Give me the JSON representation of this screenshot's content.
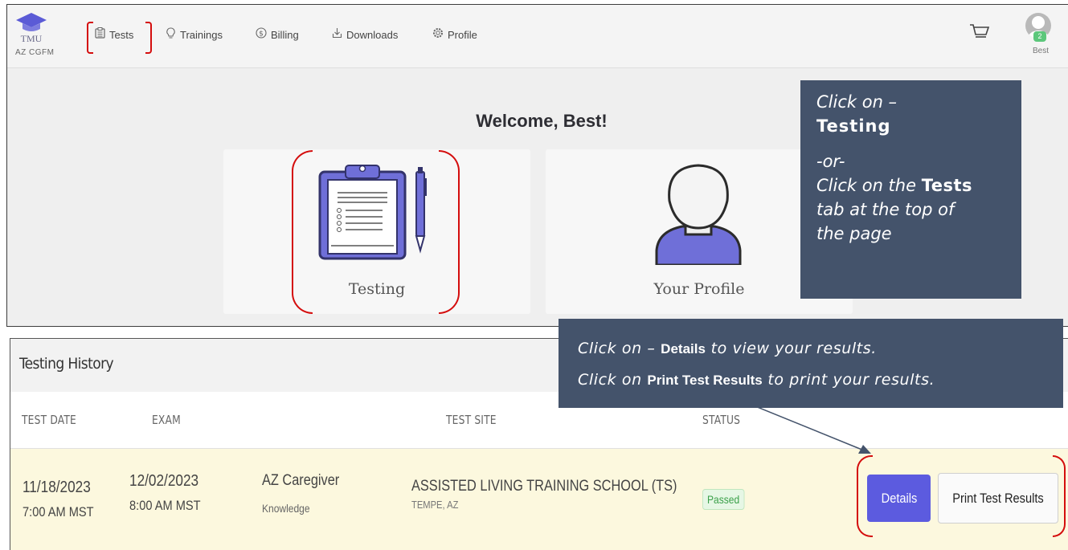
{
  "app": {
    "logo_text": "TMU",
    "org": "AZ CGFM"
  },
  "nav": {
    "items": [
      {
        "label": "Tests",
        "icon": "clipboard-icon"
      },
      {
        "label": "Trainings",
        "icon": "lightbulb-icon"
      },
      {
        "label": "Billing",
        "icon": "dollar-icon"
      },
      {
        "label": "Downloads",
        "icon": "download-icon"
      },
      {
        "label": "Profile",
        "icon": "gear-icon"
      }
    ],
    "cart_icon": "cart-icon",
    "user_badge": "2",
    "user_name": "Best"
  },
  "welcome": "Welcome, Best!",
  "cards": [
    {
      "label": "Testing",
      "icon": "clipboard-pen-icon"
    },
    {
      "label": "Your Profile",
      "icon": "person-icon"
    }
  ],
  "callout1": {
    "line1": "Click on –",
    "bold1": "Testing",
    "or": "-or-",
    "line3": "Click on the",
    "bold2": "Tests",
    "line4": "tab at the top of",
    "line5": "the page"
  },
  "callout2": {
    "a1": "Click on –",
    "b1": "Details",
    "c1": "to view your results.",
    "a2": "Click on",
    "b2": "Print Test Results",
    "c2": "to print your results."
  },
  "history": {
    "title": "Testing History",
    "columns": [
      "TEST DATE",
      "EXAM",
      "TEST SITE",
      "STATUS"
    ],
    "row": {
      "test_date": "11/18/2023",
      "test_time": "7:00 AM MST",
      "exam_date": "12/02/2023",
      "exam_time": "8:00 AM MST",
      "exam_name": "AZ Caregiver",
      "exam_type": "Knowledge",
      "site_name": "ASSISTED LIVING TRAINING SCHOOL (TS)",
      "site_location": "TEMPE, AZ",
      "status": "Passed",
      "details_label": "Details",
      "print_label": "Print Test Results"
    }
  },
  "colors": {
    "callout_bg": "#44536b",
    "accent": "#5c5bdf",
    "marker_red": "#d40d0d",
    "row_highlight": "#fcf8de"
  }
}
